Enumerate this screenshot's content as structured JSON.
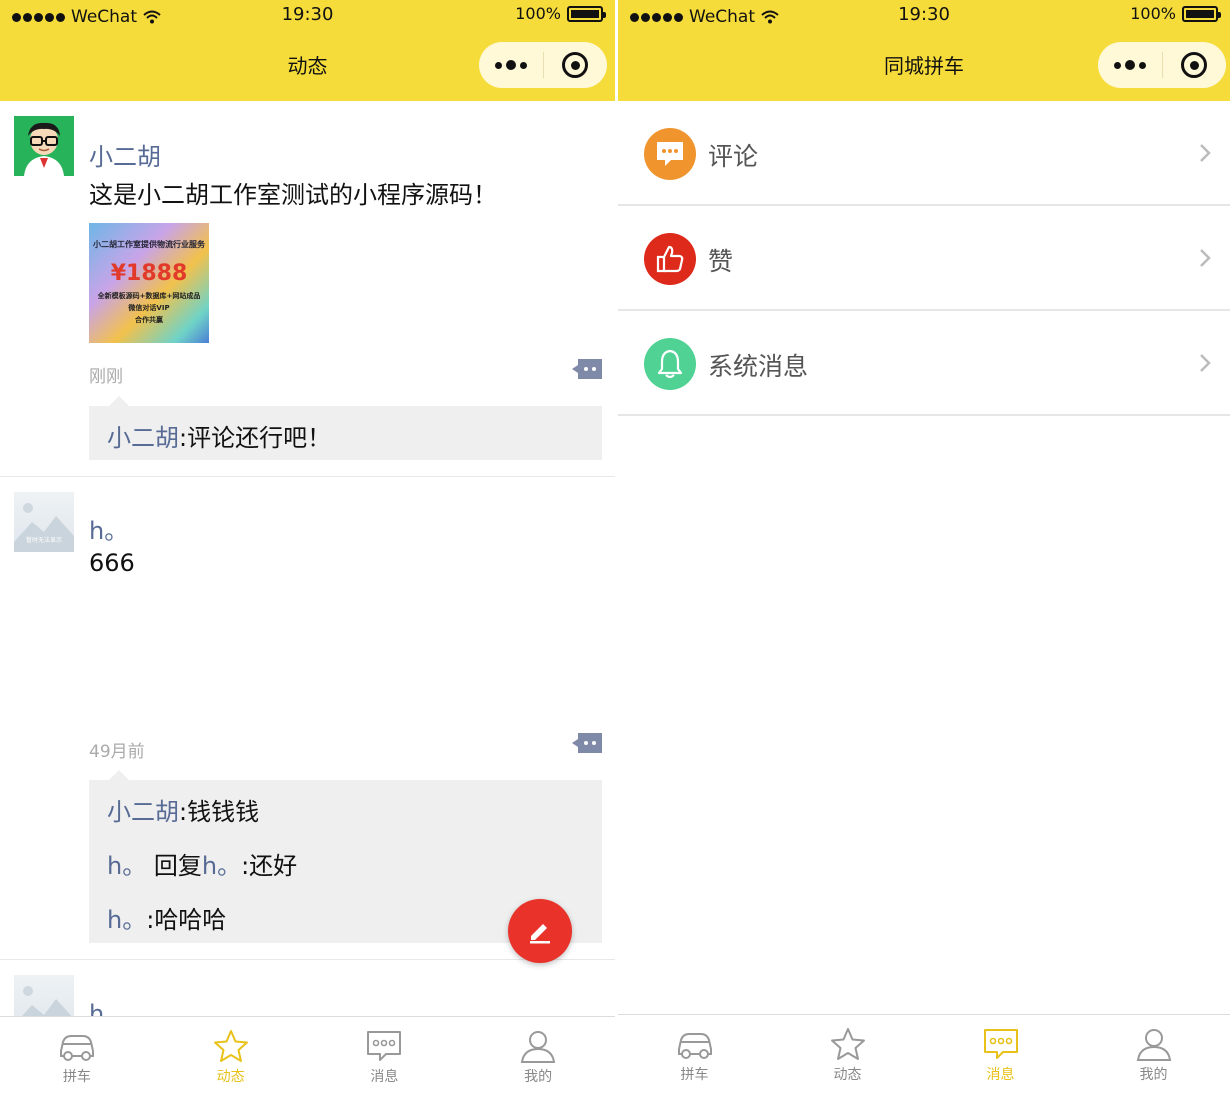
{
  "left": {
    "status": {
      "carrier": "WeChat",
      "time": "19:30",
      "battery": "100%"
    },
    "nav_title": "动态",
    "posts": [
      {
        "user": "小二胡",
        "text": "这是小二胡工作室测试的小程序源码！",
        "image": {
          "line1": "小二胡工作室提供物流行业服务",
          "price": "¥1888",
          "line2": "全新模板源码+数据库+网站成品",
          "line3": "微信对话VIP",
          "line4": "合作共赢"
        },
        "time": "刚刚",
        "comments": [
          {
            "name": "小二胡",
            "sep": ":",
            "text": "评论还行吧！"
          }
        ]
      },
      {
        "user": "h。",
        "text": "666",
        "avatar_text": "暂时无法显示",
        "time": "49月前",
        "comments": [
          {
            "name": "小二胡",
            "sep": ":",
            "text": "钱钱钱"
          },
          {
            "name": "h。",
            "reply": " 回复",
            "to": "h。",
            "sep": ":",
            "text": "还好"
          },
          {
            "name": "h。",
            "sep": ":",
            "text": "哈哈哈"
          }
        ]
      },
      {
        "user": "h。"
      }
    ],
    "tabs": [
      {
        "label": "拼车",
        "icon": "car-icon",
        "active": false
      },
      {
        "label": "动态",
        "icon": "star-icon",
        "active": true
      },
      {
        "label": "消息",
        "icon": "message-icon",
        "active": false
      },
      {
        "label": "我的",
        "icon": "user-icon",
        "active": false
      }
    ]
  },
  "right": {
    "status": {
      "carrier": "WeChat",
      "time": "19:30",
      "battery": "100%"
    },
    "nav_title": "同城拼车",
    "items": [
      {
        "label": "评论",
        "icon": "comment-icon",
        "color": "#f0952e"
      },
      {
        "label": "赞",
        "icon": "thumbs-up-icon",
        "color": "#dd2a1b"
      },
      {
        "label": "系统消息",
        "icon": "bell-icon",
        "color": "#4fd294"
      }
    ],
    "tabs": [
      {
        "label": "拼车",
        "icon": "car-icon",
        "active": false
      },
      {
        "label": "动态",
        "icon": "star-icon",
        "active": false
      },
      {
        "label": "消息",
        "icon": "message-icon",
        "active": true
      },
      {
        "label": "我的",
        "icon": "user-icon",
        "active": false
      }
    ]
  },
  "colors": {
    "header": "#f5dc3a",
    "accent_tab": "#e8c21a",
    "name_link": "#576b95",
    "fab": "#e8322a"
  }
}
